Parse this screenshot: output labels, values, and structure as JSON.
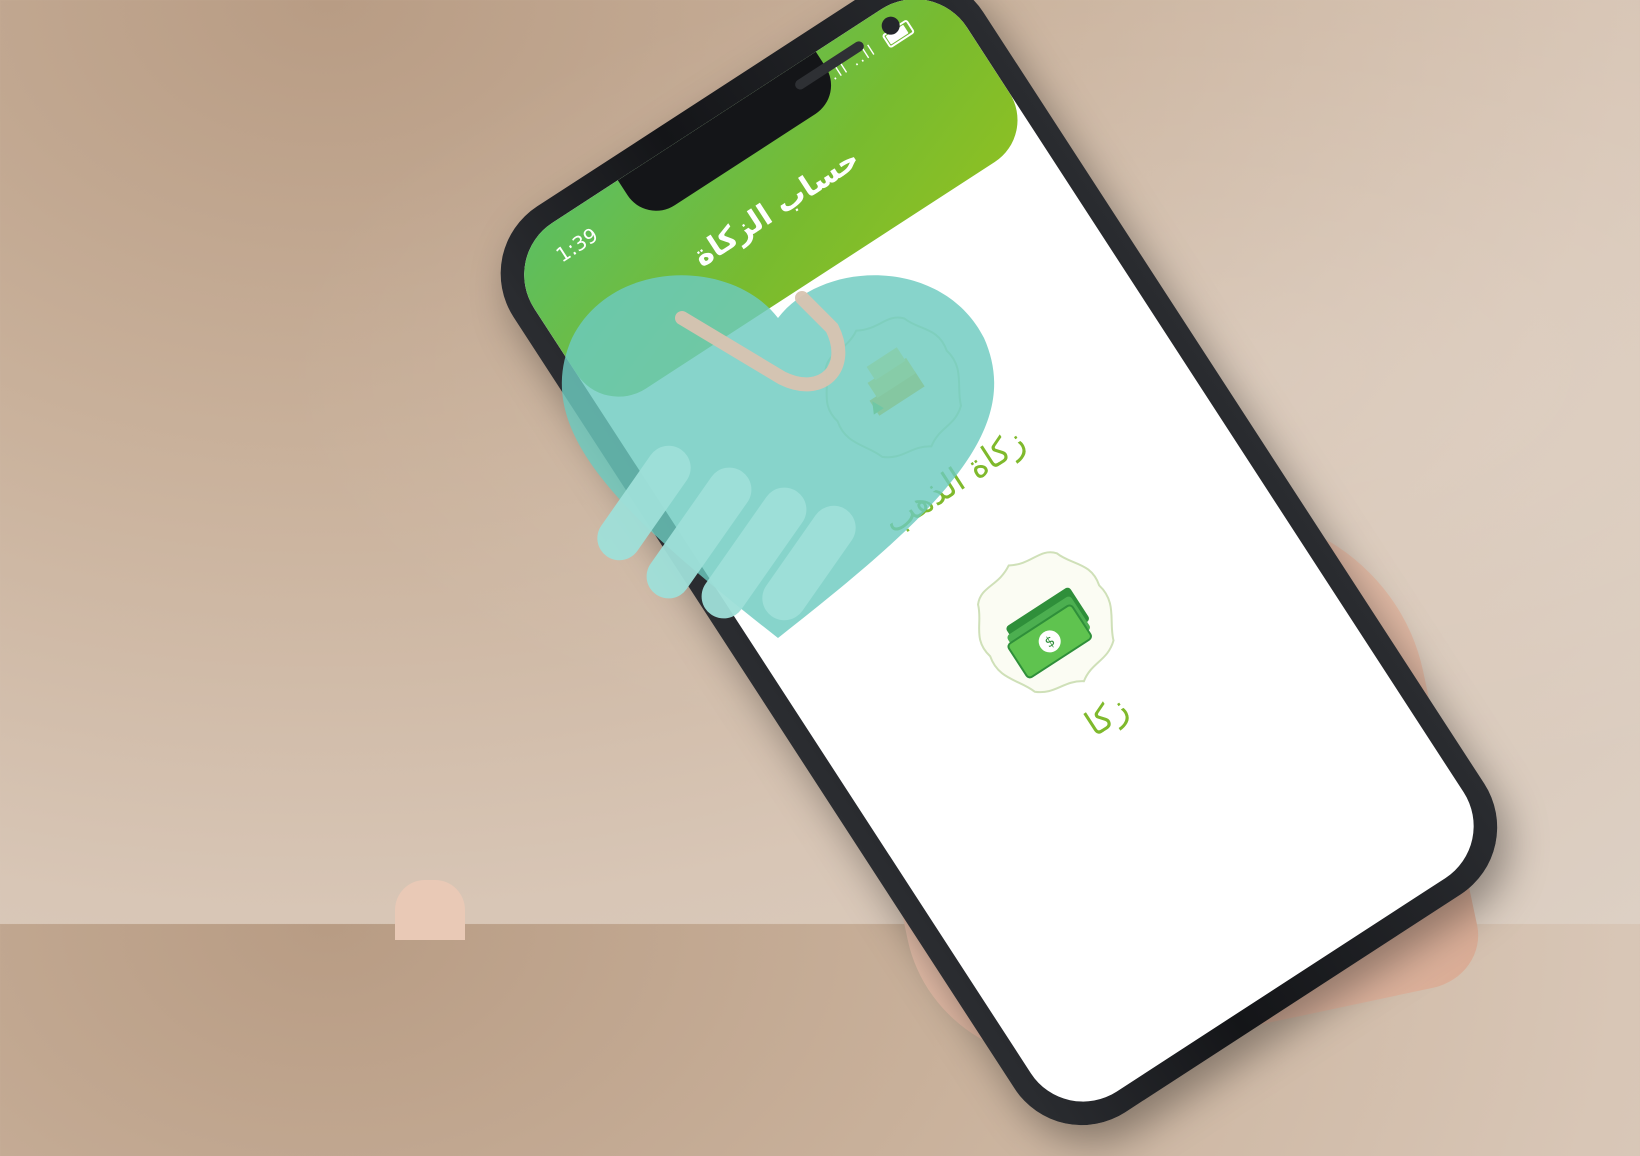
{
  "status_bar": {
    "time": "1:39",
    "signal_text": "..ll ..ll",
    "battery_text": "79"
  },
  "app": {
    "title": "حساب الزكاة"
  },
  "cards": [
    {
      "label": "زكاة الذهب",
      "icon": "gold-bars-icon"
    },
    {
      "label": "زكا",
      "icon": "cash-money-icon"
    }
  ],
  "colors": {
    "header_start": "#5cbf62",
    "header_end": "#8cc024",
    "label_green": "#7fb92c",
    "logo_teal": "#6dcbc0"
  }
}
